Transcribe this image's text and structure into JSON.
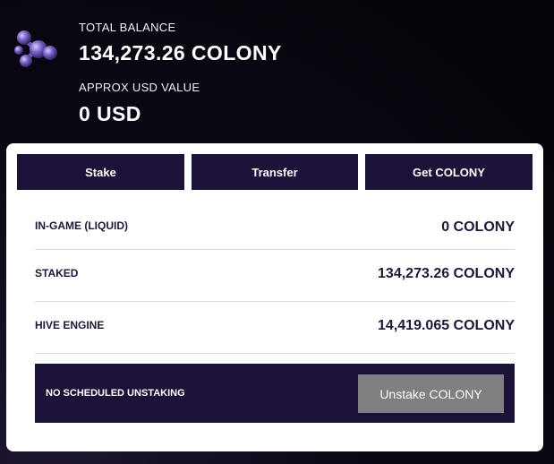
{
  "balance": {
    "total_label": "TOTAL BALANCE",
    "total_value": "134,273.26 COLONY",
    "usd_label": "APPROX USD VALUE",
    "usd_value": "0 USD"
  },
  "tabs": [
    {
      "label": "Stake"
    },
    {
      "label": "Transfer"
    },
    {
      "label": "Get COLONY"
    }
  ],
  "rows": [
    {
      "label": "IN-GAME (LIQUID)",
      "value": "0 COLONY"
    },
    {
      "label": "STAKED",
      "value": "134,273.26 COLONY"
    },
    {
      "label": "HIVE ENGINE",
      "value": "14,419.065 COLONY"
    }
  ],
  "unstake": {
    "status": "NO SCHEDULED UNSTAKING",
    "button_label": "Unstake COLONY"
  },
  "icons": {
    "logo": "colony-molecule-logo-icon"
  },
  "colors": {
    "panel_dark": "#1c1138",
    "button_gray": "#7f7f81",
    "text_dark": "#201638"
  }
}
